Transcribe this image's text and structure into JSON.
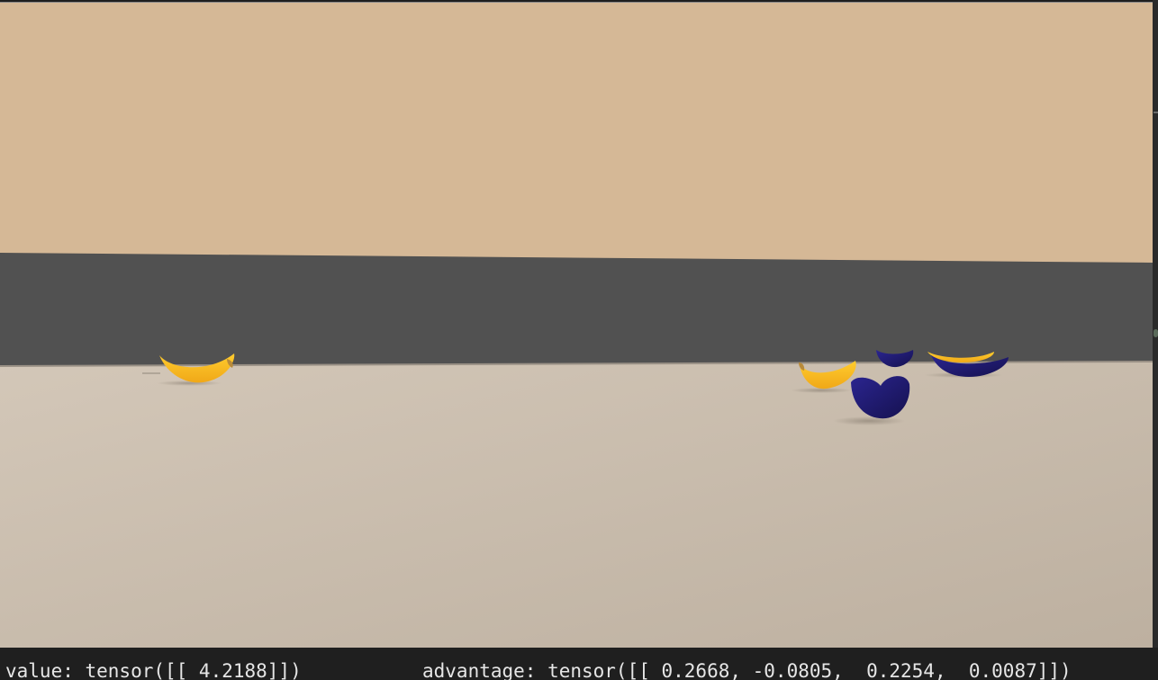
{
  "scene": {
    "sky_color": "#d5b896",
    "wall_color": "#515151",
    "floor_color_near": "#c3b6a6",
    "floor_color_far": "#d4c8b8",
    "objects": [
      {
        "type": "banana",
        "color": "yellow"
      },
      {
        "type": "banana",
        "color": "yellow"
      },
      {
        "type": "banana",
        "color": "blue"
      },
      {
        "type": "banana",
        "color": "blue"
      },
      {
        "type": "banana",
        "color": "yellow"
      },
      {
        "type": "banana",
        "color": "blue"
      }
    ],
    "colors": {
      "yellow_banana": "#f6b81e",
      "blue_banana": "#1f1a72"
    }
  },
  "console": {
    "value_text": "value: tensor([[ 4.2188]])",
    "advantage_text": "advantage: tensor([[ 0.2668, -0.0805,  0.2254,  0.0087]])"
  }
}
